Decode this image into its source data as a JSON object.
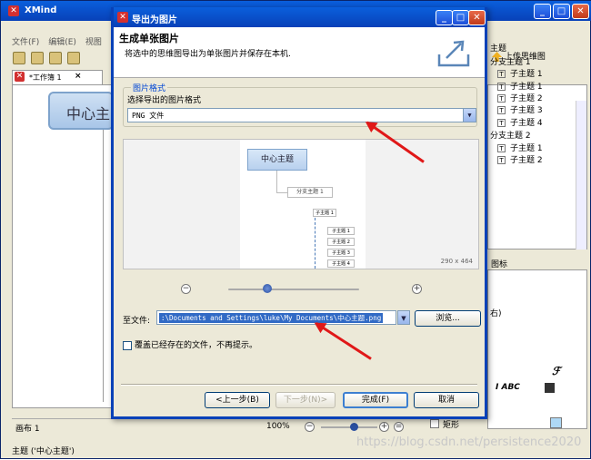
{
  "main_window": {
    "title": "XMind",
    "menu": [
      "文件(F)",
      "编辑(E)",
      "视图"
    ],
    "upload_label": "上传思维图",
    "editor_tab": "*工作簿 1",
    "center_topic": "中心主",
    "canvas_tab": "画布 1",
    "zoom_level": "100%",
    "status": "主题 ('中心主题')"
  },
  "outline_panel": {
    "items": [
      {
        "label": "主题",
        "type": "plain"
      },
      {
        "label": "分支主题 1",
        "type": "plain"
      },
      {
        "label": "子主题 1",
        "type": "topic"
      },
      {
        "label": "子主题 1",
        "type": "topic"
      },
      {
        "label": "子主题 2",
        "type": "topic"
      },
      {
        "label": "子主题 3",
        "type": "topic"
      },
      {
        "label": "子主题 4",
        "type": "topic"
      },
      {
        "label": "分支主题 2",
        "type": "plain"
      },
      {
        "label": "子主题 1",
        "type": "topic"
      },
      {
        "label": "子主题 2",
        "type": "topic"
      }
    ]
  },
  "props_panel": {
    "tab_label": "图标",
    "right_text": "右)",
    "format_symbols": "I ABC",
    "shape_label": "矩形"
  },
  "dialog": {
    "title": "导出为图片",
    "heading": "生成单张图片",
    "description": "将选中的思维图导出为单张图片并保存在本机.",
    "format_group_label": "图片格式",
    "format_prompt": "选择导出的图片格式",
    "format_value": "PNG 文件",
    "preview": {
      "center": "中心主题",
      "branch": "分支主题 1",
      "sub": "子主题 1",
      "leaves": [
        "子主题 1",
        "子主题 2",
        "子主题 3",
        "子主题 4"
      ],
      "dimensions": "290 x 464"
    },
    "zoom_level": 0.3,
    "to_file_label": "至文件:",
    "to_file_value": ":\\Documents and Settings\\luke\\My Documents\\中心主题.png",
    "browse_label": "浏览...",
    "overwrite_label": "覆盖已经存在的文件，不再提示。",
    "buttons": {
      "back": "<上一步(B)",
      "next": "下一步(N)>",
      "finish": "完成(F)",
      "cancel": "取消"
    }
  },
  "watermark": "https://blog.csdn.net/persistence2020",
  "colors": {
    "titlebar": "#0a5fdc",
    "arrow": "#e01818"
  }
}
